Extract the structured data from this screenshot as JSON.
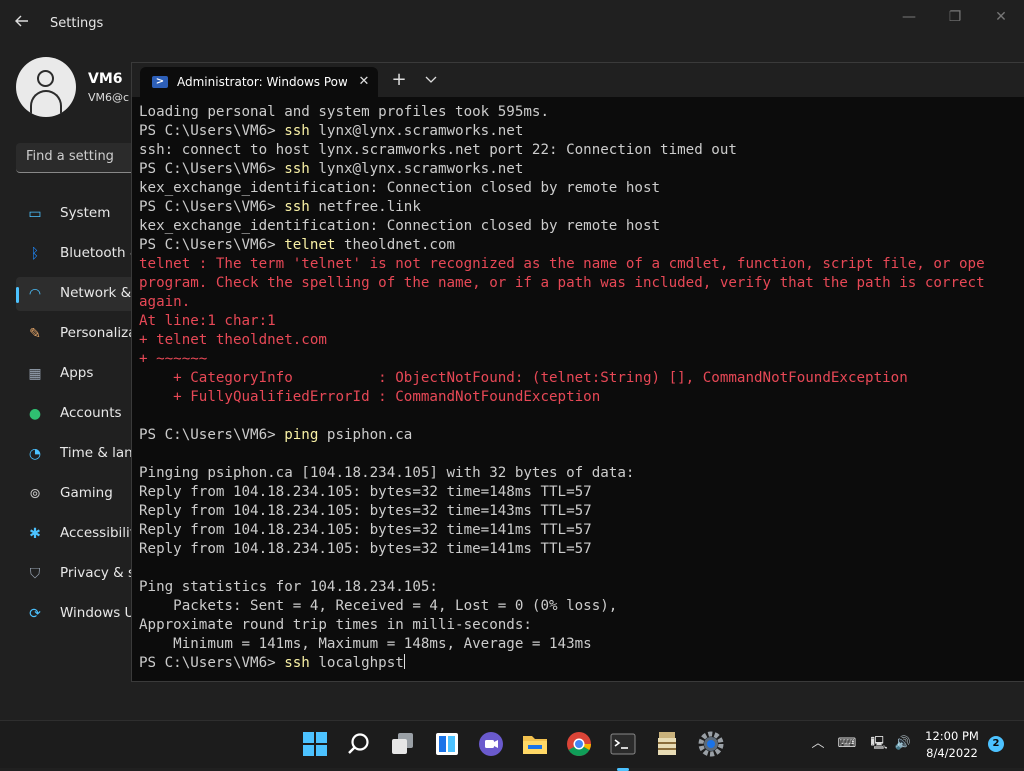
{
  "settings": {
    "title": "Settings",
    "user": {
      "name": "VM6",
      "email": "VM6@c"
    },
    "search_placeholder": "Find a setting",
    "nav": [
      {
        "label": "System",
        "icon": "display-icon",
        "color": "#4cc2ff"
      },
      {
        "label": "Bluetooth &",
        "icon": "bluetooth-icon",
        "color": "#1f8bff"
      },
      {
        "label": "Network &",
        "icon": "wifi-icon",
        "color": "#4cc2ff"
      },
      {
        "label": "Personalizat",
        "icon": "brush-icon",
        "color": "#e8a86a"
      },
      {
        "label": "Apps",
        "icon": "apps-icon",
        "color": "#9aa6b5"
      },
      {
        "label": "Accounts",
        "icon": "person-icon",
        "color": "#2fbf71"
      },
      {
        "label": "Time & lang",
        "icon": "clock-globe-icon",
        "color": "#4cc2ff"
      },
      {
        "label": "Gaming",
        "icon": "gamepad-icon",
        "color": "#c4c4c4"
      },
      {
        "label": "Accessibility",
        "icon": "accessibility-icon",
        "color": "#4cc2ff"
      },
      {
        "label": "Privacy & se",
        "icon": "shield-icon",
        "color": "#9aa6b5"
      },
      {
        "label": "Windows U",
        "icon": "sync-icon",
        "color": "#4cc2ff"
      }
    ]
  },
  "terminal": {
    "tab_title": "Administrator: Windows PowerS",
    "new_tab": "+",
    "lines": [
      {
        "t": "Loading personal and system profiles took 595ms.",
        "k": "out"
      },
      {
        "p": "PS C:\\Users\\VM6> ",
        "c": "ssh",
        "r": " lynx@lynx.scramworks.net",
        "k": "cmd"
      },
      {
        "t": "ssh: connect to host lynx.scramworks.net port 22: Connection timed out",
        "k": "out"
      },
      {
        "p": "PS C:\\Users\\VM6> ",
        "c": "ssh",
        "r": " lynx@lynx.scramworks.net",
        "k": "cmd"
      },
      {
        "t": "kex_exchange_identification: Connection closed by remote host",
        "k": "out"
      },
      {
        "p": "PS C:\\Users\\VM6> ",
        "c": "ssh",
        "r": " netfree.link",
        "k": "cmd"
      },
      {
        "t": "kex_exchange_identification: Connection closed by remote host",
        "k": "out"
      },
      {
        "p": "PS C:\\Users\\VM6> ",
        "c": "telnet",
        "r": " theoldnet.com",
        "k": "cmd"
      },
      {
        "t": "telnet : The term 'telnet' is not recognized as the name of a cmdlet, function, script file, or ope",
        "k": "err"
      },
      {
        "t": "program. Check the spelling of the name, or if a path was included, verify that the path is correct",
        "k": "err"
      },
      {
        "t": "again.",
        "k": "err"
      },
      {
        "t": "At line:1 char:1",
        "k": "err"
      },
      {
        "t": "+ telnet theoldnet.com",
        "k": "err"
      },
      {
        "t": "+ ~~~~~~",
        "k": "err"
      },
      {
        "t": "    + CategoryInfo          : ObjectNotFound: (telnet:String) [], CommandNotFoundException",
        "k": "err"
      },
      {
        "t": "    + FullyQualifiedErrorId : CommandNotFoundException",
        "k": "err"
      },
      {
        "t": "",
        "k": "out"
      },
      {
        "p": "PS C:\\Users\\VM6> ",
        "c": "ping",
        "r": " psiphon.ca",
        "k": "cmd"
      },
      {
        "t": "",
        "k": "out"
      },
      {
        "t": "Pinging psiphon.ca [104.18.234.105] with 32 bytes of data:",
        "k": "out"
      },
      {
        "t": "Reply from 104.18.234.105: bytes=32 time=148ms TTL=57",
        "k": "out"
      },
      {
        "t": "Reply from 104.18.234.105: bytes=32 time=143ms TTL=57",
        "k": "out"
      },
      {
        "t": "Reply from 104.18.234.105: bytes=32 time=141ms TTL=57",
        "k": "out"
      },
      {
        "t": "Reply from 104.18.234.105: bytes=32 time=141ms TTL=57",
        "k": "out"
      },
      {
        "t": "",
        "k": "out"
      },
      {
        "t": "Ping statistics for 104.18.234.105:",
        "k": "out"
      },
      {
        "t": "    Packets: Sent = 4, Received = 4, Lost = 0 (0% loss),",
        "k": "out"
      },
      {
        "t": "Approximate round trip times in milli-seconds:",
        "k": "out"
      },
      {
        "t": "    Minimum = 141ms, Maximum = 148ms, Average = 143ms",
        "k": "out"
      },
      {
        "p": "PS C:\\Users\\VM6> ",
        "c": "ssh",
        "r": " localghpst",
        "k": "cmd",
        "cursor": true
      }
    ]
  },
  "taskbar": {
    "apps": [
      {
        "name": "start-button",
        "icon": "windows-logo-icon"
      },
      {
        "name": "search-button",
        "icon": "search-icon"
      },
      {
        "name": "task-view-button",
        "icon": "task-view-icon"
      },
      {
        "name": "widgets-button",
        "icon": "widgets-icon"
      },
      {
        "name": "teams-chat-button",
        "icon": "chat-camera-icon"
      },
      {
        "name": "file-explorer-button",
        "icon": "folder-icon"
      },
      {
        "name": "chrome-button",
        "icon": "chrome-icon"
      },
      {
        "name": "terminal-button",
        "icon": "terminal-icon",
        "active": true
      },
      {
        "name": "archive-app-button",
        "icon": "archive-icon"
      },
      {
        "name": "settings-button",
        "icon": "gear-icon"
      }
    ],
    "time": "12:00 PM",
    "date": "8/4/2022",
    "notifications": "2"
  }
}
